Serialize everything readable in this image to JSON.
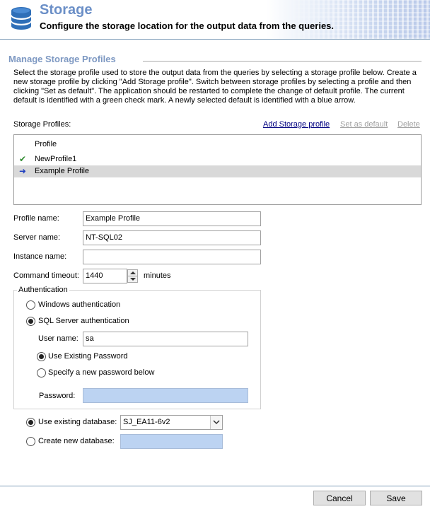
{
  "header": {
    "title": "Storage",
    "subtitle": "Configure the storage location for the output data from the queries.",
    "icon": "database-icon"
  },
  "section": {
    "title": "Manage Storage Profiles",
    "description": "Select the storage profile used to store the output data from the queries by selecting a storage profile below. Create a new storage profile by clicking \"Add Storage profile\". Switch between storage profiles by selecting a profile and then clicking \"Set as default\". The application should be restarted to complete the change of default profile. The current default is identified with a green check mark. A newly selected default is identified with a blue arrow."
  },
  "profiles": {
    "label": "Storage Profiles:",
    "add_link": "Add Storage profile",
    "set_default_link": "Set as default",
    "delete_link": "Delete",
    "column_header": "Profile",
    "rows": [
      {
        "name": "NewProfile1",
        "mark": "✔",
        "mark_icon": "green-check-icon",
        "mark_color": "#2e8b2e"
      },
      {
        "name": "Example Profile",
        "mark": "➜",
        "mark_icon": "blue-arrow-icon",
        "mark_color": "#1f3fbf",
        "selected": true
      }
    ]
  },
  "form": {
    "profile_name_label": "Profile name:",
    "profile_name_value": "Example Profile",
    "server_name_label": "Server name:",
    "server_name_value": "NT-SQL02",
    "instance_name_label": "Instance name:",
    "instance_name_value": "",
    "command_timeout_label": "Command timeout:",
    "command_timeout_value": "1440",
    "command_timeout_unit": "minutes"
  },
  "authentication": {
    "group_label": "Authentication",
    "windows_label": "Windows authentication",
    "sql_label": "SQL Server authentication",
    "selected": "sql",
    "user_name_label": "User name:",
    "user_name_value": "sa",
    "use_existing_password_label": "Use Existing Password",
    "specify_new_password_label": "Specify a new password below",
    "password_choice": "existing",
    "password_label": "Password:",
    "password_value": ""
  },
  "database": {
    "use_existing_label": "Use existing database:",
    "existing_value": "SJ_EA11-6v2",
    "create_new_label": "Create new database:",
    "new_value": "",
    "selected": "existing"
  },
  "footer": {
    "cancel_label": "Cancel",
    "save_label": "Save"
  },
  "colors": {
    "title_blue": "#6b8fc7",
    "section_blue": "#7d98c2",
    "link_navy": "#000080",
    "disabled_field": "#bcd3f2",
    "selected_row": "#d9d9d9"
  }
}
